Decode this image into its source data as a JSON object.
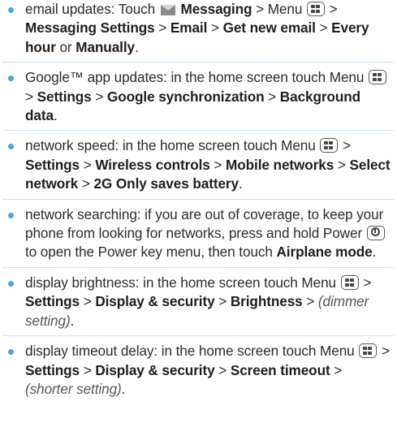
{
  "tips": [
    {
      "segments": [
        {
          "t": "email updates: Touch ",
          "s": "n"
        },
        {
          "icon": "envelope-icon"
        },
        {
          "t": " Messaging",
          "s": "b"
        },
        {
          "t": " > Menu ",
          "s": "n"
        },
        {
          "icon": "menu-key-icon"
        },
        {
          "t": " > ",
          "s": "n"
        },
        {
          "t": "Messaging Settings",
          "s": "b"
        },
        {
          "t": " > ",
          "s": "n"
        },
        {
          "t": "Email",
          "s": "b"
        },
        {
          "t": " > ",
          "s": "n"
        },
        {
          "t": "Get new email",
          "s": "b"
        },
        {
          "t": " > ",
          "s": "n"
        },
        {
          "t": "Every hour",
          "s": "b"
        },
        {
          "t": " or ",
          "s": "n"
        },
        {
          "t": "Manually",
          "s": "b"
        },
        {
          "t": ".",
          "s": "n"
        }
      ]
    },
    {
      "segments": [
        {
          "t": "Google™ app updates: in the home screen touch Menu ",
          "s": "n"
        },
        {
          "icon": "menu-key-icon"
        },
        {
          "t": " > ",
          "s": "n"
        },
        {
          "t": "Settings",
          "s": "b"
        },
        {
          "t": " > ",
          "s": "n"
        },
        {
          "t": "Google synchronization",
          "s": "b"
        },
        {
          "t": " > ",
          "s": "n"
        },
        {
          "t": "Background data",
          "s": "b"
        },
        {
          "t": ".",
          "s": "n"
        }
      ]
    },
    {
      "segments": [
        {
          "t": "network speed: in the home screen touch Menu ",
          "s": "n"
        },
        {
          "icon": "menu-key-icon"
        },
        {
          "t": " > ",
          "s": "n"
        },
        {
          "t": "Settings",
          "s": "b"
        },
        {
          "t": " > ",
          "s": "n"
        },
        {
          "t": "Wireless controls",
          "s": "b"
        },
        {
          "t": " > ",
          "s": "n"
        },
        {
          "t": "Mobile networks",
          "s": "b"
        },
        {
          "t": " > ",
          "s": "n"
        },
        {
          "t": "Select network",
          "s": "b"
        },
        {
          "t": " > ",
          "s": "n"
        },
        {
          "t": "2G Only saves battery",
          "s": "b"
        },
        {
          "t": ".",
          "s": "n"
        }
      ]
    },
    {
      "segments": [
        {
          "t": "network searching: if you are out of coverage, to keep your phone from looking for networks, press and hold Power ",
          "s": "n"
        },
        {
          "icon": "power-key-icon"
        },
        {
          "t": " to open the Power key menu, then touch ",
          "s": "n"
        },
        {
          "t": "Airplane mode",
          "s": "b"
        },
        {
          "t": ".",
          "s": "n"
        }
      ]
    },
    {
      "segments": [
        {
          "t": "display brightness: in the home screen touch Menu ",
          "s": "n"
        },
        {
          "icon": "menu-key-icon"
        },
        {
          "t": " > ",
          "s": "n"
        },
        {
          "t": "Settings",
          "s": "b"
        },
        {
          "t": " > ",
          "s": "n"
        },
        {
          "t": "Display & security",
          "s": "b"
        },
        {
          "t": " > ",
          "s": "n"
        },
        {
          "t": "Brightness",
          "s": "b"
        },
        {
          "t": " > ",
          "s": "n"
        },
        {
          "t": "(dimmer setting)",
          "s": "i"
        },
        {
          "t": ".",
          "s": "n"
        }
      ]
    },
    {
      "segments": [
        {
          "t": "display timeout delay: in the home screen touch Menu ",
          "s": "n"
        },
        {
          "icon": "menu-key-icon"
        },
        {
          "t": " > ",
          "s": "n"
        },
        {
          "t": "Settings",
          "s": "b"
        },
        {
          "t": " > ",
          "s": "n"
        },
        {
          "t": "Display & security",
          "s": "b"
        },
        {
          "t": " > ",
          "s": "n"
        },
        {
          "t": "Screen timeout",
          "s": "b"
        },
        {
          "t": " > ",
          "s": "n"
        },
        {
          "t": "(shorter setting)",
          "s": "i"
        },
        {
          "t": ".",
          "s": "n"
        }
      ]
    }
  ]
}
